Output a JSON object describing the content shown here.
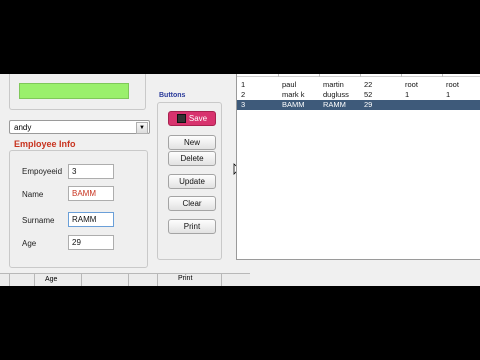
{
  "combo": {
    "value": "andy"
  },
  "employee_panel": {
    "title": "Employee Info",
    "fields": [
      {
        "label": "Empoyeeid",
        "value": "3"
      },
      {
        "label": "Name",
        "value": "BAMM"
      },
      {
        "label": "Surname",
        "value": "RAMM"
      },
      {
        "label": "Age",
        "value": "29"
      }
    ]
  },
  "buttons_panel": {
    "title": "Buttons",
    "save": "Save",
    "new": "New",
    "delete": "Delete",
    "update": "Update",
    "clear": "Clear",
    "print": "Print"
  },
  "table": {
    "rows": [
      [
        "1",
        "paul",
        "martin",
        "22",
        "root",
        "root"
      ],
      [
        "2",
        "mark k",
        "dugluss",
        "52",
        "1",
        "1"
      ],
      [
        "3",
        "BAMM",
        "RAMM",
        "29",
        "",
        ""
      ]
    ],
    "selected_index": 2
  },
  "bottom_strip": {
    "age_cell": "Age",
    "print_cell": "Print"
  },
  "colors": {
    "status_green": "#9af06c",
    "save_pink": "#d8336e",
    "header_red": "#c8331f",
    "buttons_title_blue": "#2a3a9a",
    "selected_row": "#3e5a7a"
  }
}
